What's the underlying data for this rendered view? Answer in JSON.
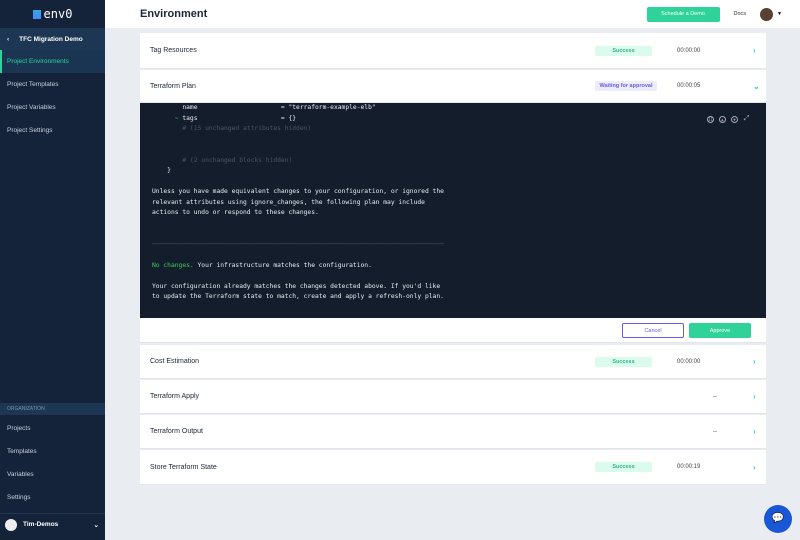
{
  "sidebar": {
    "logo": "env0",
    "project": "TFC Migration Demo",
    "items": [
      "Project Environments",
      "Project Templates",
      "Project Variables",
      "Project Settings"
    ],
    "org_label": "ORGANIZATION",
    "org_items": [
      "Projects",
      "Templates",
      "Variables",
      "Settings"
    ],
    "user": "Tim-Demos"
  },
  "header": {
    "title": "Environment",
    "schedule": "Schedule a Demo",
    "docs": "Docs"
  },
  "steps": [
    {
      "name": "Tag Resources",
      "status": "Success",
      "time": "00:00:00"
    },
    {
      "name": "Terraform Plan",
      "status": "Waiting for approval",
      "time": "00:00:05"
    },
    {
      "name": "Cost Estimation",
      "status": "Success",
      "time": "00:00:00"
    },
    {
      "name": "Terraform Apply",
      "status": "",
      "time": "--"
    },
    {
      "name": "Terraform Output",
      "status": "",
      "time": "--"
    },
    {
      "name": "Store Terraform State",
      "status": "Success",
      "time": "00:00:19"
    }
  ],
  "terminal": {
    "l1": "        name                      = \"terraform-example-elb\"",
    "l2_mark": "      ~ ",
    "l2": "tags                      = {}",
    "l3": "        # (15 unchanged attributes hidden)",
    "l4": "        # (2 unchanged blocks hidden)",
    "l5": "    }",
    "p1": "Unless you have made equivalent changes to your configuration, or ignored the\nrelevant attributes using ignore_changes, the following plan may include\nactions to undo or respond to these changes.",
    "rule": "─────────────────────────────────────────────────────────────────────────────",
    "nc": "No changes.",
    "nc_rest": " Your infrastructure matches the configuration.",
    "p2": "Your configuration already matches the changes detected above. If you'd like\nto update the Terraform state to match, create and apply a refresh-only plan."
  },
  "actions": {
    "cancel": "Cancel",
    "approve": "Approve"
  }
}
